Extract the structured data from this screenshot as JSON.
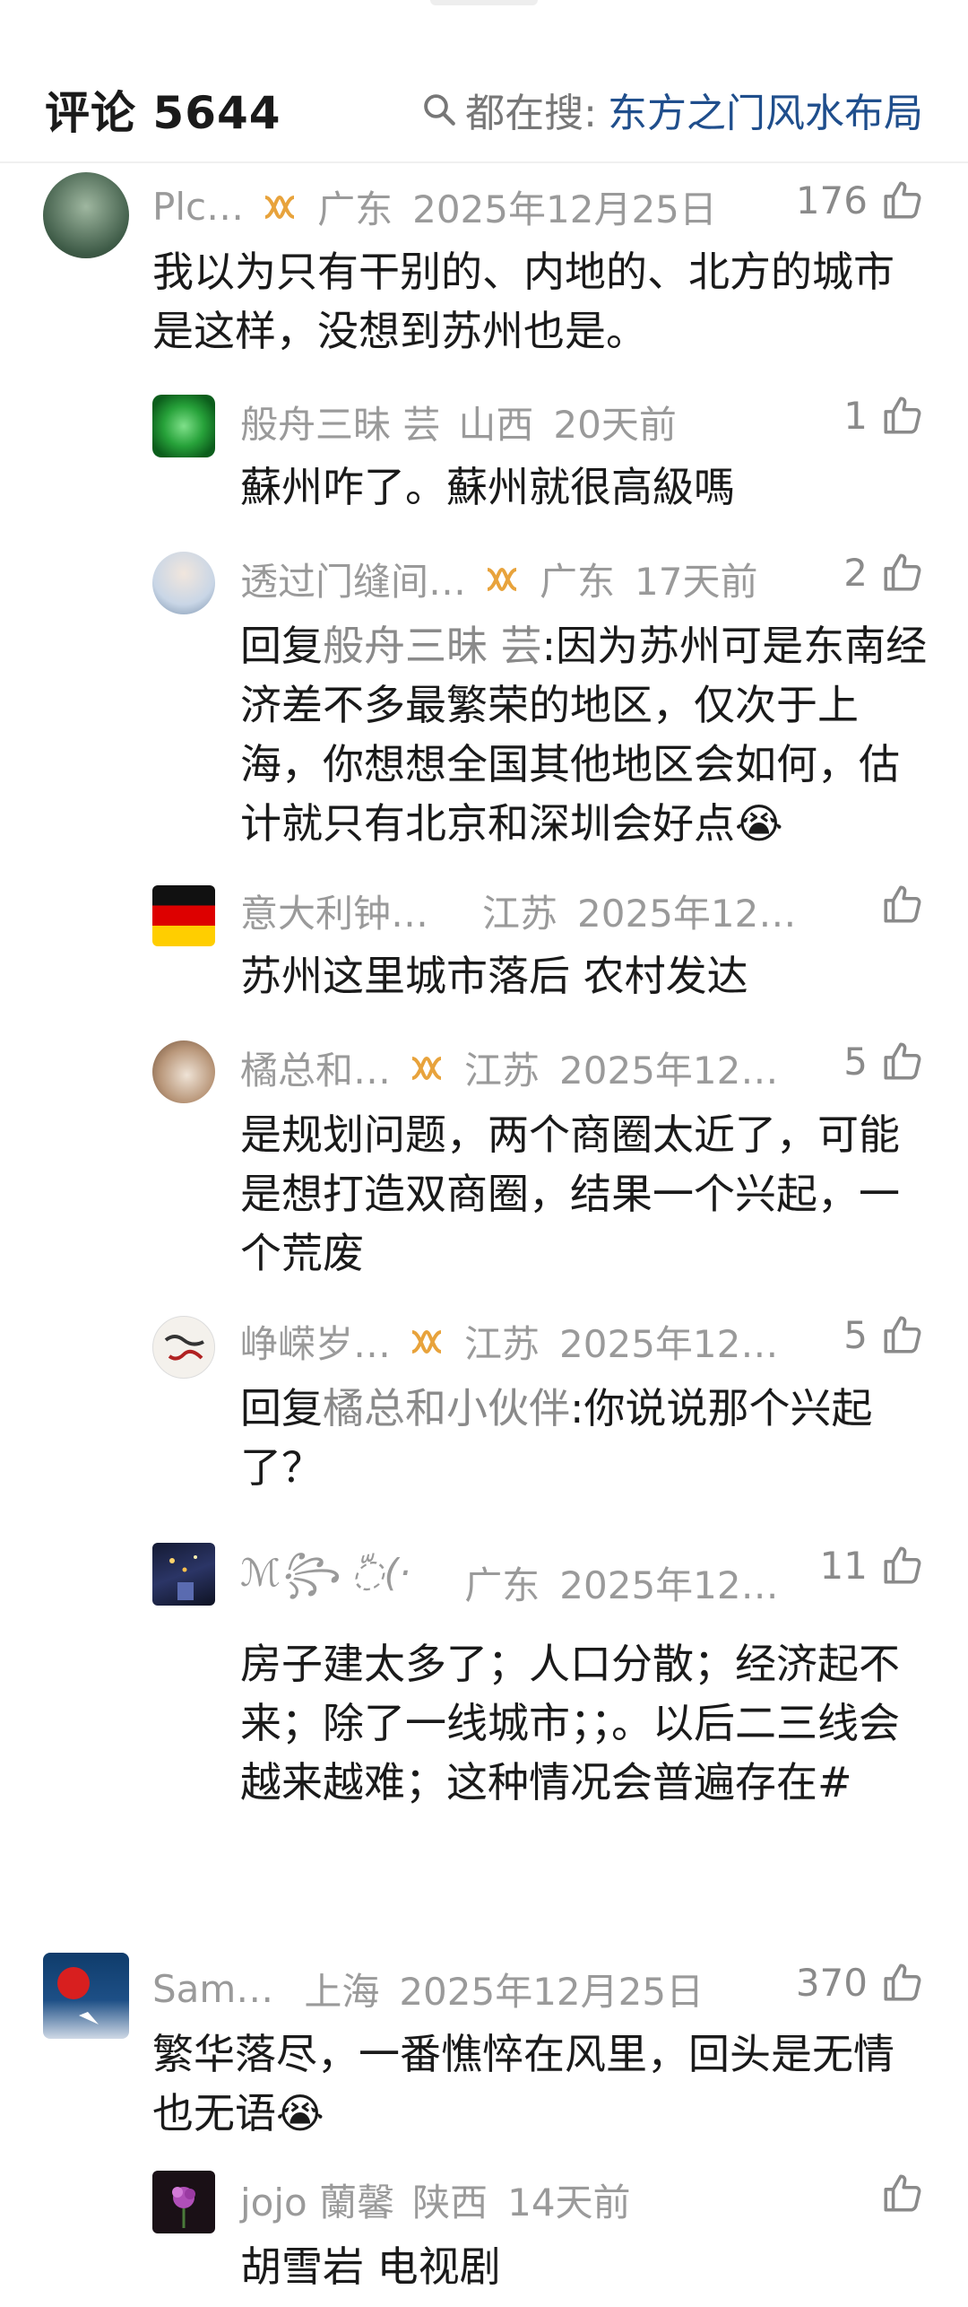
{
  "header": {
    "title": "评论 5644",
    "search_label": "都在搜:",
    "search_keyword": "东方之门风水布局"
  },
  "comments": [
    {
      "name": "Plc…",
      "region": "广东",
      "time": "2025年12月25日",
      "likes": "176",
      "text": "我以为只有干别的、内地的、北方的城市是这样，没想到苏州也是。"
    },
    {
      "name": "般舟三昧 芸",
      "region": "山西",
      "time": "20天前",
      "likes": "1",
      "text": "蘇州咋了。蘇州就很高級嗎"
    },
    {
      "name": "透过门缝间…",
      "region": "广东",
      "time": "17天前",
      "likes": "2",
      "reply_prefix": "回复",
      "reply_to": "般舟三昧 芸",
      "text": ":因为苏州可是东南经济差不多最繁荣的地区，仅次于上海，你想想全国其他地区会如何，估计就只有北京和深圳会好点",
      "emoji": "😭"
    },
    {
      "name": "意大利钟…",
      "region": "江苏",
      "time": "2025年12…",
      "likes": "",
      "text": "苏州这里城市落后 农村发达"
    },
    {
      "name": "橘总和…",
      "region": "江苏",
      "time": "2025年12…",
      "likes": "5",
      "text": "是规划问题，两个商圈太近了，可能是想打造双商圈，结果一个兴起，一个荒废"
    },
    {
      "name": "峥嵘岁…",
      "region": "江苏",
      "time": "2025年12…",
      "likes": "5",
      "reply_prefix": "回复",
      "reply_to": "橘总和小伙伴",
      "text": ":你说说那个兴起了？"
    },
    {
      "name": "ℳ꧂ ◌ّ(·",
      "region": "广东",
      "time": "2025年12…",
      "likes": "11",
      "text": "房子建太多了；人口分散；经济起不来；除了一线城市；；。以后二三线会越来越难；这种情况会普遍存在#"
    },
    {
      "name": "Sam…",
      "region": "上海",
      "time": "2025年12月25日",
      "likes": "370",
      "text": "繁华落尽，一番憔悴在风里，回头是无情也无语",
      "emoji": "😭"
    },
    {
      "name": "jojo 蘭馨",
      "region": "陕西",
      "time": "14天前",
      "likes": "",
      "text": "胡雪岩 电视剧"
    }
  ],
  "icons": {
    "badge": "vip-badge-icon",
    "like": "thumbs-up-icon",
    "search": "search-icon",
    "flag": "germany-flag-icon"
  },
  "colors": {
    "badge": "#e8a33c",
    "link": "#1f4e8c",
    "meta": "#9a9a9a"
  }
}
